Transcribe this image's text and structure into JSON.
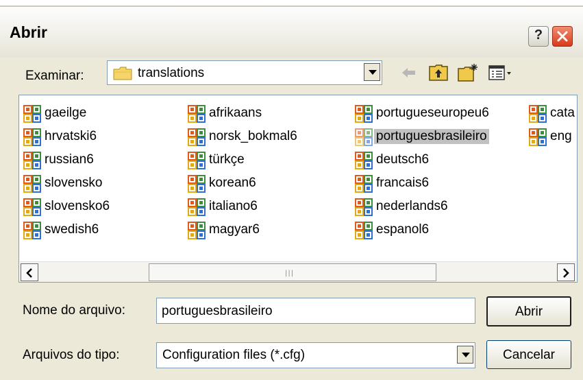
{
  "dialog": {
    "title": "Abrir"
  },
  "look_in": {
    "label": "Examinar:",
    "value": "translations"
  },
  "files": [
    {
      "name": "gaeilge"
    },
    {
      "name": "hrvatski6"
    },
    {
      "name": "russian6"
    },
    {
      "name": "slovensko"
    },
    {
      "name": "slovensko6"
    },
    {
      "name": "swedish6"
    },
    {
      "name": "afrikaans"
    },
    {
      "name": "norsk_bokmal6"
    },
    {
      "name": "türkçe"
    },
    {
      "name": "korean6"
    },
    {
      "name": "italiano6"
    },
    {
      "name": "magyar6"
    },
    {
      "name": "portugueseuropeu6"
    },
    {
      "name": "portuguesbrasileiro",
      "selected": true
    },
    {
      "name": "deutsch6"
    },
    {
      "name": "francais6"
    },
    {
      "name": "nederlands6"
    },
    {
      "name": "espanol6"
    },
    {
      "name": "cata"
    },
    {
      "name": "eng"
    }
  ],
  "filename": {
    "label": "Nome do arquivo:",
    "value": "portuguesbrasileiro"
  },
  "filetype": {
    "label": "Arquivos do tipo:",
    "value": "Configuration files (*.cfg)"
  },
  "buttons": {
    "open": "Abrir",
    "cancel": "Cancelar",
    "help": "?"
  }
}
